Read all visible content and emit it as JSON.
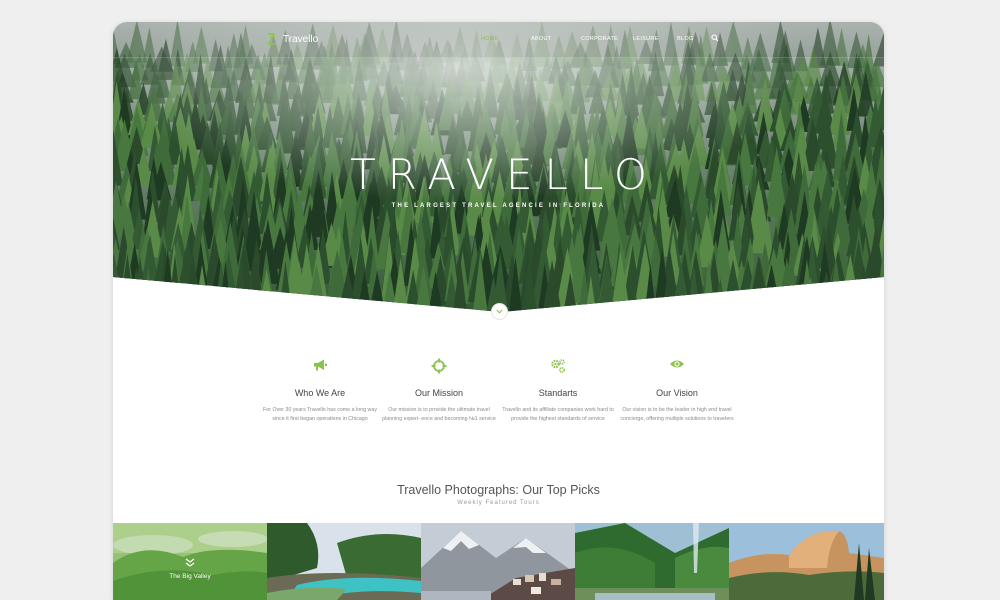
{
  "brand": {
    "name": "Travello"
  },
  "nav": {
    "items": [
      {
        "label": "HOME",
        "active": true
      },
      {
        "label": "ABOUT",
        "active": false
      },
      {
        "label": "CORPORATE",
        "active": false
      },
      {
        "label": "LEISURE",
        "active": false
      },
      {
        "label": "BLOG",
        "active": false
      }
    ],
    "search_icon": "search-icon"
  },
  "hero": {
    "title": "TRAVELLO",
    "subtitle": "THE LARGEST TRAVEL AGENCIE IN FLORIDA"
  },
  "features": [
    {
      "icon": "megaphone-icon",
      "title": "Who We Are",
      "text": "For Over 30 years Travello has come a long way since it first began operations in Chicago"
    },
    {
      "icon": "crosshair-icon",
      "title": "Our Mission",
      "text": "Our mission is to provide the ultimate travel planning experi- ence and becoming №1 service"
    },
    {
      "icon": "gears-icon",
      "title": "Standarts",
      "text": "Travello and its affiliate companies work hard to provide the highest standards of service"
    },
    {
      "icon": "eye-icon",
      "title": "Our Vision",
      "text": "Our vision is to be the leader in high end travel concierge, offering multiple solutions to travelers"
    }
  ],
  "photos": {
    "title": "Travello Photographs: Our Top Picks",
    "subtitle": "Weekly Featured Tours",
    "tiles": [
      {
        "caption": "The Big Valley"
      },
      {
        "caption": ""
      },
      {
        "caption": ""
      },
      {
        "caption": ""
      },
      {
        "caption": ""
      }
    ]
  },
  "colors": {
    "accent": "#8bc34a",
    "forest_dark": "#1f3a22",
    "background": "#efefef"
  }
}
